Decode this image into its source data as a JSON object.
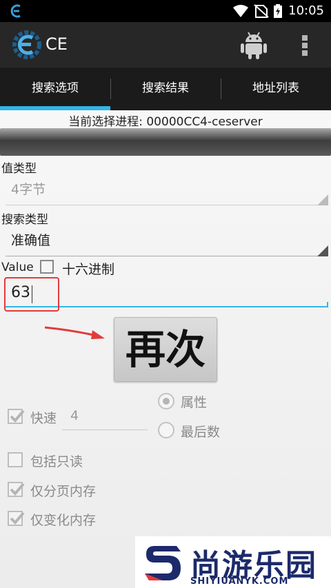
{
  "status_bar": {
    "time": "10:05",
    "icons": [
      "wifi-icon",
      "no-sim-icon",
      "battery-charging-icon"
    ]
  },
  "action_bar": {
    "title": "CE",
    "logo_icon": "cheat-engine-logo",
    "icons": [
      "android-icon",
      "overflow-menu-icon"
    ]
  },
  "tabs": [
    {
      "label": "搜索选项",
      "selected": true
    },
    {
      "label": "搜索结果",
      "selected": false
    },
    {
      "label": "地址列表",
      "selected": false
    }
  ],
  "process": {
    "label": "当前选择进程: 00000CC4-ceserver"
  },
  "value_type": {
    "label": "值类型",
    "selected": "4字节"
  },
  "search_type": {
    "label": "搜索类型",
    "selected": "准确值"
  },
  "value": {
    "label": "Value",
    "hex_label": "十六进制",
    "hex_checked": false,
    "input": "63"
  },
  "again_button": "再次",
  "options": {
    "fast_label": "快速",
    "fast_checked": true,
    "fast_value": "4",
    "attr_radio": "属性",
    "attr_selected": true,
    "last_digits_radio": "最后数",
    "last_digits_selected": false,
    "readonly_label": "包括只读",
    "readonly_checked": false,
    "paged_label": "仅分页内存",
    "paged_checked": true,
    "changed_label": "仅变化内存",
    "changed_checked": true
  },
  "watermark": {
    "title": "尚游乐园",
    "subtitle": "SHIYIUANYK.COM"
  },
  "colors": {
    "accent": "#33b5e5",
    "highlight": "#e43a3a",
    "action_bar": "#272727",
    "tab_bar": "#1b1b1b"
  }
}
